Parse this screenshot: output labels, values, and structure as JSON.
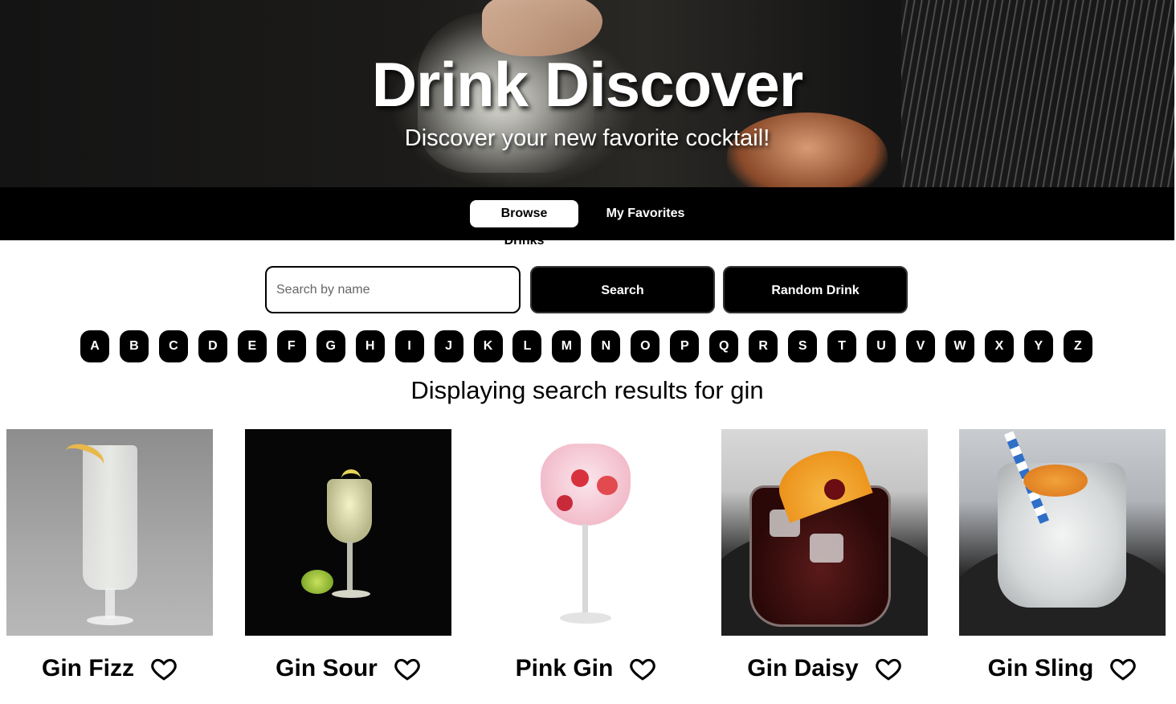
{
  "hero": {
    "title": "Drink Discover",
    "subtitle": "Discover your new favorite cocktail!"
  },
  "nav": {
    "tabs": [
      {
        "label": "Browse Drinks",
        "active": true
      },
      {
        "label": "My Favorites",
        "active": false
      }
    ]
  },
  "search": {
    "placeholder": "Search by name",
    "value": "",
    "search_label": "Search",
    "random_label": "Random Drink"
  },
  "letters": [
    "A",
    "B",
    "C",
    "D",
    "E",
    "F",
    "G",
    "H",
    "I",
    "J",
    "K",
    "L",
    "M",
    "N",
    "O",
    "P",
    "Q",
    "R",
    "S",
    "T",
    "U",
    "V",
    "W",
    "X",
    "Y",
    "Z"
  ],
  "results": {
    "caption": "Displaying search results for gin",
    "drinks": [
      {
        "name": "Gin Fizz",
        "favorite_icon": "heart-outline-icon"
      },
      {
        "name": "Gin Sour",
        "favorite_icon": "heart-outline-icon"
      },
      {
        "name": "Pink Gin",
        "favorite_icon": "heart-outline-icon"
      },
      {
        "name": "Gin Daisy",
        "favorite_icon": "heart-outline-icon"
      },
      {
        "name": "Gin Sling",
        "favorite_icon": "heart-outline-icon"
      }
    ]
  },
  "colors": {
    "nav_background": "#000000",
    "button_background": "#000000",
    "button_text": "#ffffff",
    "active_tab_background": "#ffffff"
  }
}
